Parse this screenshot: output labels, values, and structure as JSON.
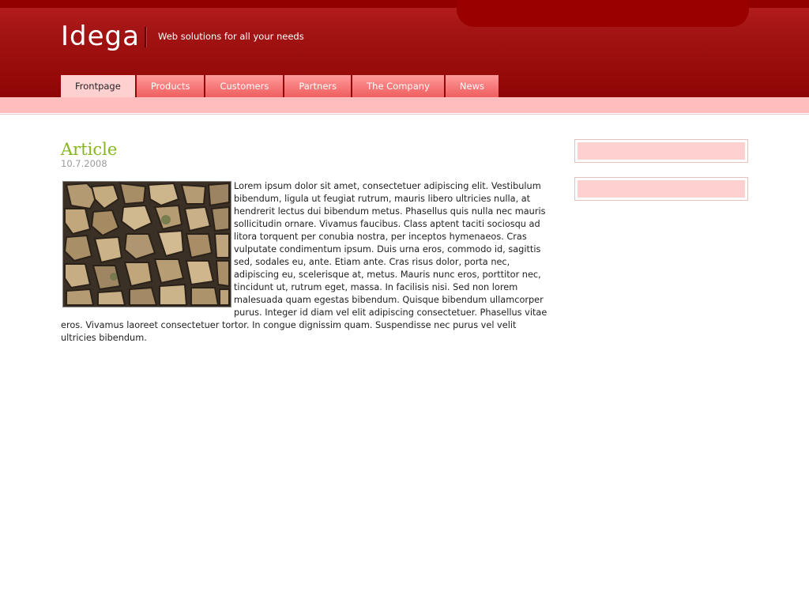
{
  "header": {
    "logo": "Idega",
    "slogan": "Web solutions for all your needs"
  },
  "nav": {
    "tabs": [
      {
        "label": "Frontpage",
        "active": true
      },
      {
        "label": "Products",
        "active": false
      },
      {
        "label": "Customers",
        "active": false
      },
      {
        "label": "Partners",
        "active": false
      },
      {
        "label": "The Company",
        "active": false
      },
      {
        "label": "News",
        "active": false
      }
    ]
  },
  "article": {
    "title": "Article",
    "date": "10.7.2008",
    "body": "Lorem ipsum dolor sit amet, consectetuer adipiscing elit. Vestibulum bibendum, ligula ut feugiat rutrum, mauris libero ultricies nulla, at hendrerit lectus dui bibendum metus. Phasellus quis nulla nec mauris sollicitudin ornare. Vivamus faucibus. Class aptent taciti sociosqu ad litora torquent per conubia nostra, per inceptos hymenaeos. Cras vulputate condimentum ipsum. Duis urna eros, commodo id, sagittis sed, sodales eu, ante. Etiam ante. Cras risus dolor, porta nec, adipiscing eu, scelerisque at, metus. Mauris nunc eros, porttitor nec, tincidunt ut, rutrum eget, massa. In facilisis nisi. Sed non lorem malesuada quam egestas bibendum. Quisque bibendum ullamcorper purus. Integer id diam vel elit adipiscing consectetuer. Phasellus vitae eros. Vivamus laoreet consectetuer tortor. In congue dignissim quam. Suspendisse nec purus vel velit ultricies bibendum."
  },
  "colors": {
    "header_red": "#a31414",
    "tab_pink": "#ff8080",
    "subbar_pink": "#ffbdbd",
    "title_green": "#86b51f"
  }
}
